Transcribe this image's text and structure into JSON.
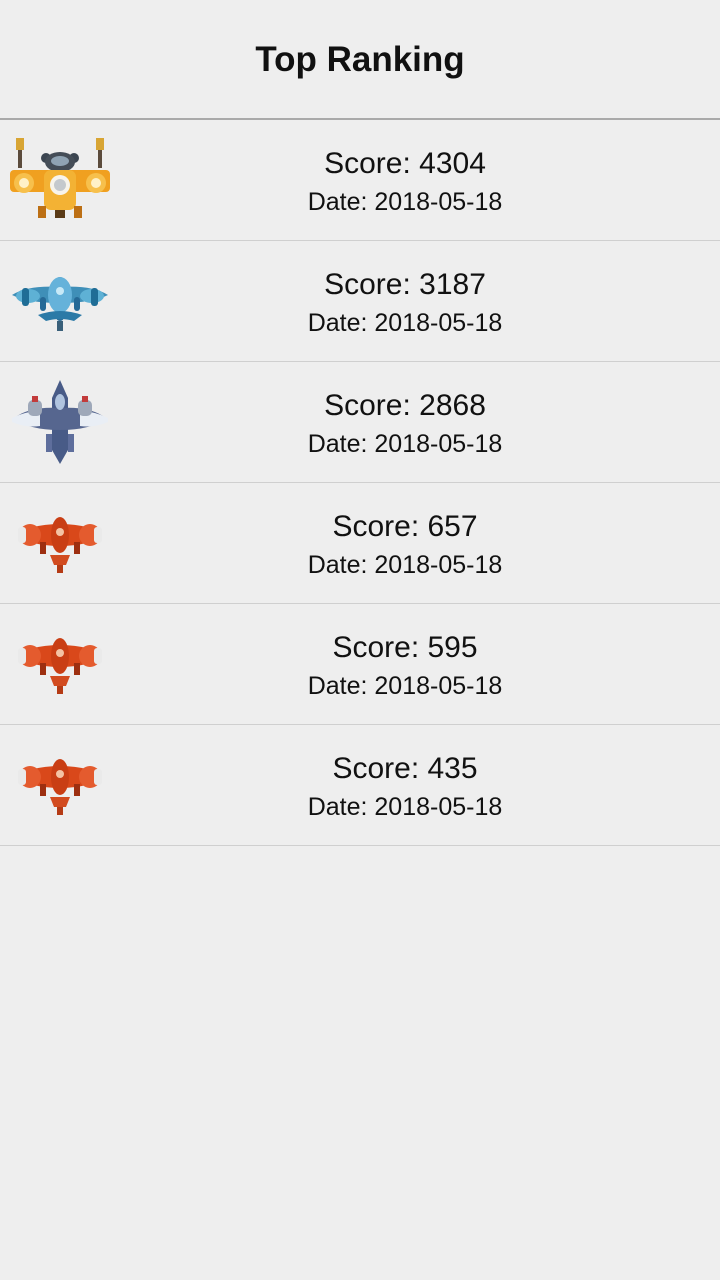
{
  "header": {
    "title": "Top Ranking"
  },
  "rankings": [
    {
      "score": "Score: 4304",
      "date": "Date: 2018-05-18",
      "icon": "orange-heavy-plane-icon"
    },
    {
      "score": "Score: 3187",
      "date": "Date: 2018-05-18",
      "icon": "blue-plane-icon"
    },
    {
      "score": "Score: 2868",
      "date": "Date: 2018-05-18",
      "icon": "steel-blue-plane-icon"
    },
    {
      "score": "Score: 657",
      "date": "Date: 2018-05-18",
      "icon": "red-plane-icon"
    },
    {
      "score": "Score: 595",
      "date": "Date: 2018-05-18",
      "icon": "red-plane-icon"
    },
    {
      "score": "Score: 435",
      "date": "Date: 2018-05-18",
      "icon": "red-plane-icon"
    }
  ],
  "colors": {
    "background": "#eeeeee",
    "divider": "#cfcfcf",
    "header_divider": "#a9a9a9",
    "orange_plane": "#f0a020",
    "blue_plane": "#3f8fb8",
    "steel_plane": "#4a5a86",
    "red_plane": "#d9481a"
  }
}
